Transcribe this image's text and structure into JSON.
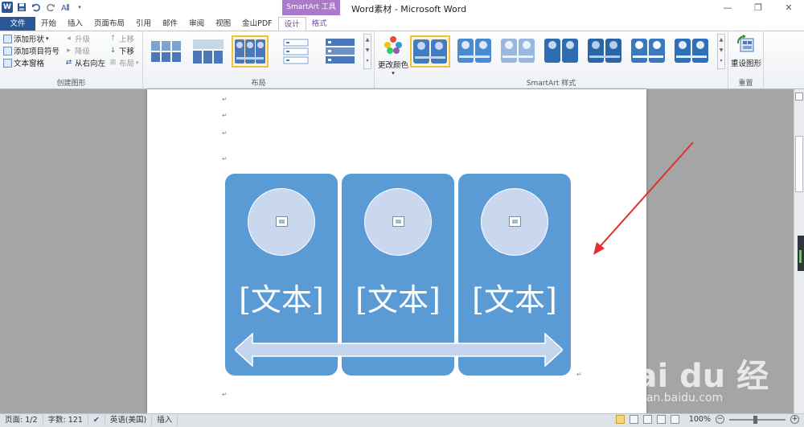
{
  "window": {
    "title": "Word素材 - Microsoft Word",
    "context_tool": "SmartArt 工具",
    "controls": {
      "minimize": "—",
      "restore": "❐",
      "close": "✕"
    }
  },
  "quick_access": {
    "word_icon": "W",
    "save_icon": "save-icon",
    "undo_icon": "undo-icon",
    "redo_icon": "redo-icon",
    "format_icon": "format-painter-icon"
  },
  "tabs": [
    {
      "label": "文件"
    },
    {
      "label": "开始"
    },
    {
      "label": "插入"
    },
    {
      "label": "页面布局"
    },
    {
      "label": "引用"
    },
    {
      "label": "邮件"
    },
    {
      "label": "审阅"
    },
    {
      "label": "视图"
    },
    {
      "label": "金山PDF"
    },
    {
      "label": "设计"
    },
    {
      "label": "格式"
    }
  ],
  "ribbon": {
    "create_graphic": {
      "label": "创建图形",
      "add_shape": "添加形状",
      "add_bullet": "添加项目符号",
      "text_pane": "文本窗格",
      "promote": "升级",
      "demote": "降级",
      "rtl": "从右向左",
      "move_up": "上移",
      "move_down": "下移",
      "layout": "布局"
    },
    "layouts": {
      "label": "布局"
    },
    "styles": {
      "label": "SmartArt 样式",
      "change_colors": "更改颜色"
    },
    "reset": {
      "label": "重置",
      "reset_graphic": "重设图形"
    }
  },
  "document": {
    "paragraph_mark": "↵",
    "smartart_panels": [
      {
        "text": "[文本]"
      },
      {
        "text": "[文本]"
      },
      {
        "text": "[文本]"
      }
    ]
  },
  "status": {
    "page": "页面: 1/2",
    "words": "字数: 121",
    "language": "英语(美国)",
    "mode": "插入",
    "zoom": "100%",
    "zoom_minus": "−",
    "zoom_plus": "+"
  },
  "watermark": {
    "logo": "Bai du 经验",
    "url": "jingyan.baidu.com"
  },
  "colors": {
    "panel_fill": "#5b9bd5",
    "circle_fill": "#c9d8ee",
    "arrow_fill": "#c3d5ec",
    "annotation_arrow": "#e03030",
    "file_tab": "#2b5797",
    "context_tool": "#a87ac9"
  }
}
